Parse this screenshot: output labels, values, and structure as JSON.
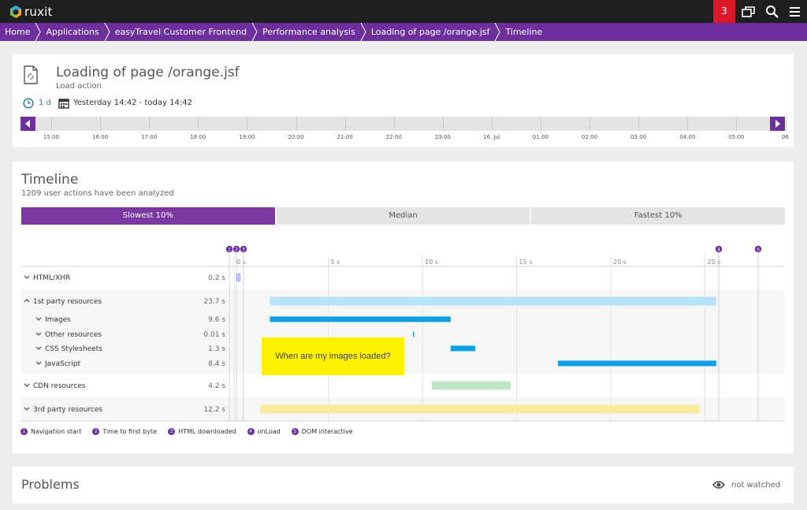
{
  "app": {
    "brand": "ruxit",
    "notification_count": "3",
    "icons": [
      "logo-icon",
      "windows-icon",
      "search-icon",
      "menu-icon"
    ]
  },
  "breadcrumb": [
    "Home",
    "Applications",
    "easyTravel Customer Frontend",
    "Performance analysis",
    "Loading of page /orange.jsf",
    "Timeline"
  ],
  "header": {
    "title": "Loading of page /orange.jsf",
    "subtitle": "Load action",
    "duration": "1 d",
    "range": "Yesterday 14:42 - today 14:42",
    "time_ticks": [
      "15:00",
      "16:00",
      "17:00",
      "18:00",
      "19:00",
      "20:00",
      "21:00",
      "22:00",
      "23:00",
      "16. Jul",
      "01:00",
      "02:00",
      "03:00",
      "04:00",
      "05:00",
      "06"
    ]
  },
  "timeline": {
    "title": "Timeline",
    "subtitle": "1209 user actions have been analyzed",
    "tabs": [
      {
        "label": "Slowest 10%",
        "active": true
      },
      {
        "label": "Median",
        "active": false
      },
      {
        "label": "Fastest 10%",
        "active": false
      }
    ],
    "axis_ticks": [
      "0 s",
      "5 s",
      "10 s",
      "15 s",
      "20 s",
      "25 s"
    ],
    "markers": [
      {
        "id": "1",
        "t": 0.0
      },
      {
        "id": "2",
        "t": 0.2
      },
      {
        "id": "3",
        "t": 0.5
      },
      {
        "id": "4",
        "t": 25.5
      },
      {
        "id": "5",
        "t": 27.6
      }
    ],
    "rows": [
      {
        "label": "HTML/XHR",
        "value": "0.2 s",
        "level": 0,
        "expanded": false,
        "start": 0.1,
        "end": 0.35,
        "color": "#b6c3f2"
      },
      {
        "label": "1st party resources",
        "value": "23.7 s",
        "level": 0,
        "expanded": true,
        "start": 1.9,
        "end": 25.6,
        "color": "#b8e2f7"
      },
      {
        "label": "Images",
        "value": "9.6 s",
        "level": 1,
        "expanded": false,
        "start": 1.9,
        "end": 11.5,
        "color": "#0ea0e3"
      },
      {
        "label": "Other resources",
        "value": "0.01 s",
        "level": 1,
        "expanded": false,
        "start": 9.5,
        "end": 9.56,
        "color": "#0ea0e3"
      },
      {
        "label": "CSS Stylesheets",
        "value": "1.3 s",
        "level": 1,
        "expanded": false,
        "start": 11.5,
        "end": 12.8,
        "color": "#0ea0e3"
      },
      {
        "label": "JavaScript",
        "value": "8.4 s",
        "level": 1,
        "expanded": false,
        "start": 17.2,
        "end": 25.6,
        "color": "#0ea0e3"
      },
      {
        "label": "CDN resources",
        "value": "4.2 s",
        "level": 0,
        "expanded": false,
        "start": 10.5,
        "end": 14.7,
        "color": "#bfe8c6"
      },
      {
        "label": "3rd party resources",
        "value": "12.2 s",
        "level": 0,
        "expanded": false,
        "start": 1.4,
        "end": 24.7,
        "color": "#f9eb9c"
      }
    ],
    "annotation": "When are my images loaded?",
    "legend": [
      {
        "id": "1",
        "label": "Navigation start"
      },
      {
        "id": "2",
        "label": "Time to first byte"
      },
      {
        "id": "3",
        "label": "HTML downloaded"
      },
      {
        "id": "4",
        "label": "onLoad"
      },
      {
        "id": "5",
        "label": "DOM interactive"
      }
    ]
  },
  "problems": {
    "title": "Problems",
    "watch_label": "not watched"
  },
  "colors": {
    "accent": "#6d2f9c",
    "notification": "#dc172a",
    "topbar": "#1e1e1e"
  }
}
